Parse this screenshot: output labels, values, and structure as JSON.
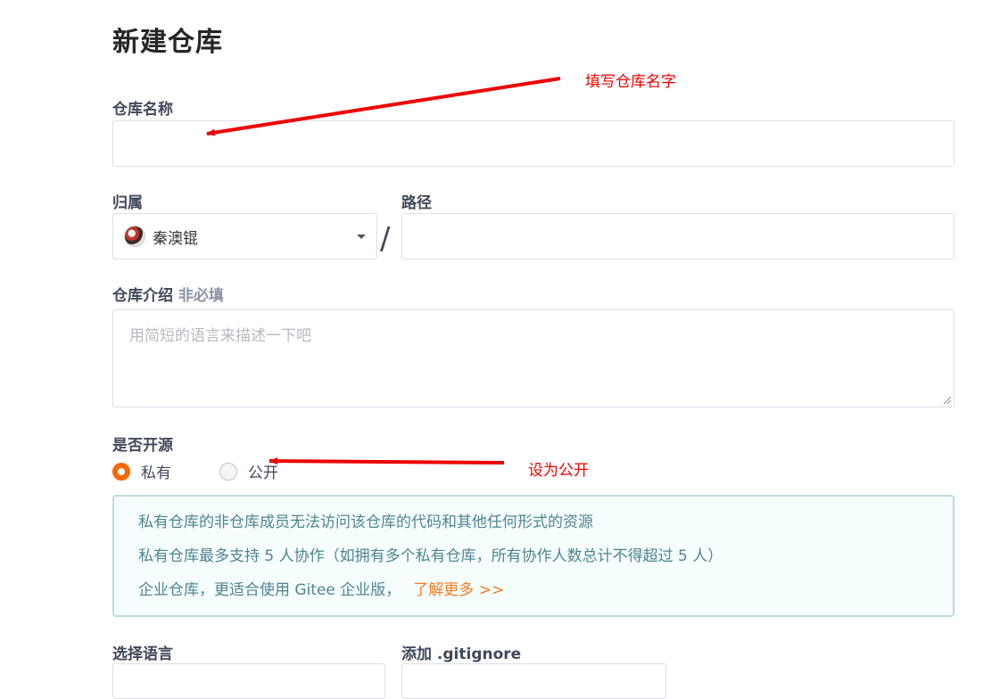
{
  "page_title": "新建仓库",
  "repo_name": {
    "label": "仓库名称",
    "value": ""
  },
  "owner": {
    "label": "归属",
    "selected": "秦澳锟"
  },
  "separator": "/",
  "path": {
    "label": "路径",
    "value": ""
  },
  "description": {
    "label": "仓库介绍",
    "optional": "非必填",
    "placeholder": "用简短的语言来描述一下吧"
  },
  "visibility": {
    "label": "是否开源",
    "options": [
      {
        "label": "私有",
        "checked": true
      },
      {
        "label": "公开",
        "checked": false
      }
    ]
  },
  "info": {
    "line1": "私有仓库的非仓库成员无法访问该仓库的代码和其他任何形式的资源",
    "line2": "私有仓库最多支持 5 人协作（如拥有多个私有仓库，所有协作人数总计不得超过 5 人）",
    "line3": "企业仓库，更适合使用 Gitee 企业版，",
    "link": "了解更多 >>"
  },
  "language": {
    "label": "选择语言"
  },
  "gitignore": {
    "label": "添加 .gitignore"
  },
  "annotations": {
    "name_hint": "填写仓库名字",
    "public_hint": "设为公开"
  },
  "colors": {
    "accent": "#f76707",
    "annotation": "#ee0000",
    "info_text": "#4f8590"
  },
  "icons": {
    "owner_avatar": "avatar",
    "owner_dropdown": "caret-down-icon"
  }
}
